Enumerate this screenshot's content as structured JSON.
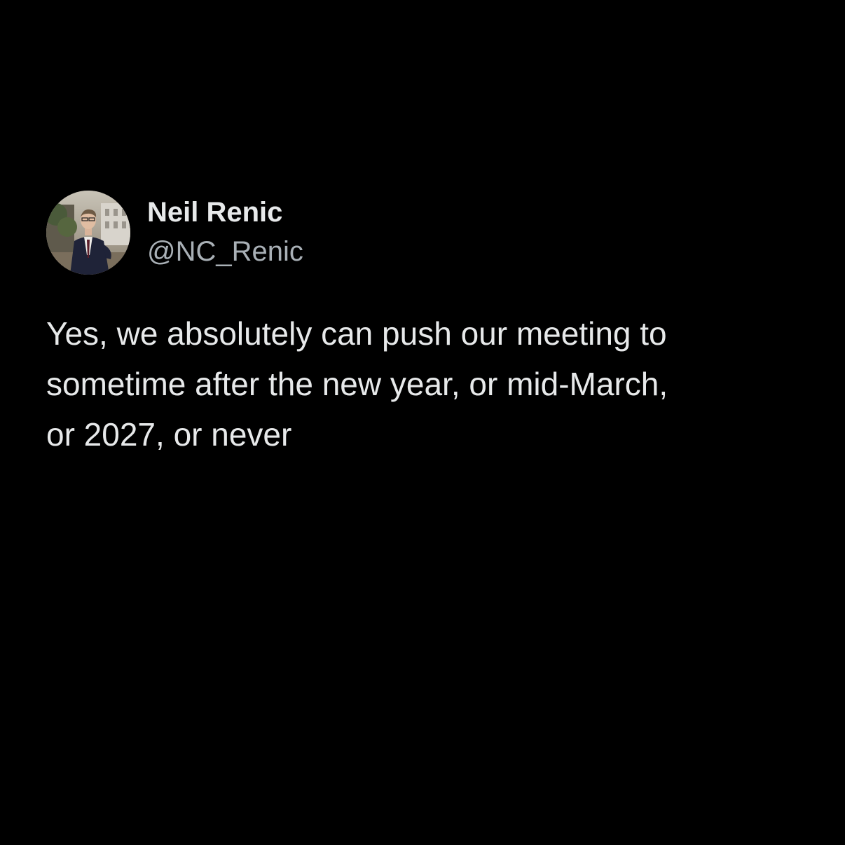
{
  "tweet": {
    "display_name": "Neil Renic",
    "handle": "@NC_Renic",
    "text": "Yes, we absolutely can push our meeting to\nsometime after the new year, or mid-March,\nor 2027, or never",
    "avatar_icon": "profile-photo",
    "colors": {
      "background": "#000000",
      "text": "#e7e9ea",
      "handle": "#a9b0b6"
    }
  }
}
